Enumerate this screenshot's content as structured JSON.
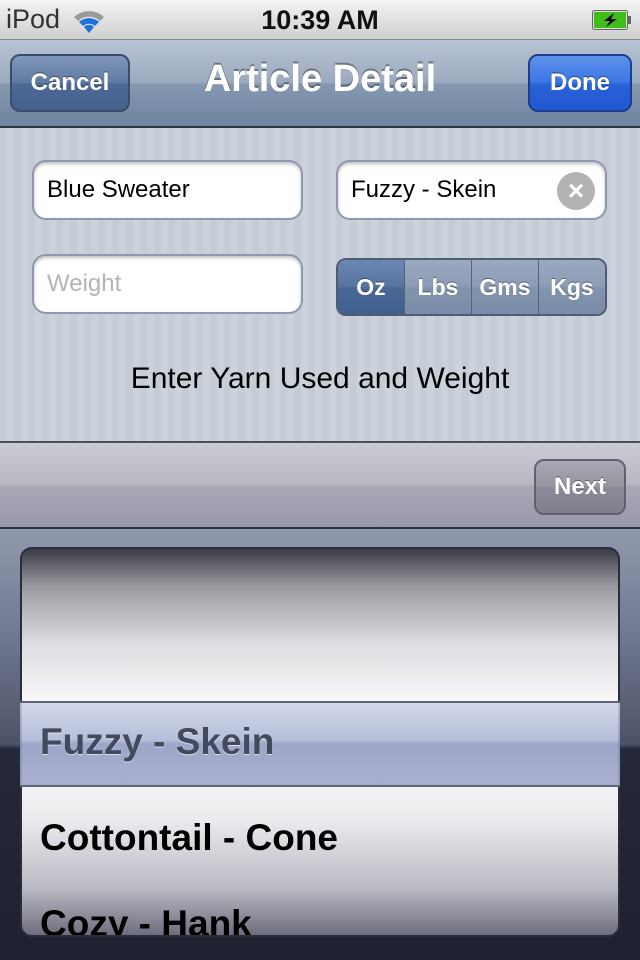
{
  "status_bar": {
    "carrier": "iPod",
    "time": "10:39 AM",
    "wifi_icon": "wifi-icon",
    "battery_icon": "battery-charging-icon"
  },
  "nav_bar": {
    "title": "Article Detail",
    "cancel_label": "Cancel",
    "done_label": "Done"
  },
  "form": {
    "article_name_value": "Blue Sweater",
    "yarn_value": "Fuzzy - Skein",
    "clear_icon": "clear-icon",
    "weight_placeholder": "Weight",
    "weight_value": "",
    "units": [
      {
        "label": "Oz",
        "selected": true
      },
      {
        "label": "Lbs",
        "selected": false
      },
      {
        "label": "Gms",
        "selected": false
      },
      {
        "label": "Kgs",
        "selected": false
      }
    ],
    "hint": "Enter Yarn Used and Weight"
  },
  "toolbar": {
    "next_label": "Next"
  },
  "picker": {
    "selected": "Fuzzy - Skein",
    "rows": [
      "Cottontail - Cone",
      "Cozy - Hank"
    ]
  },
  "colors": {
    "done_button": "#2a62d8",
    "cancel_button": "#4d6995",
    "segment_selected": "#4a6895"
  }
}
